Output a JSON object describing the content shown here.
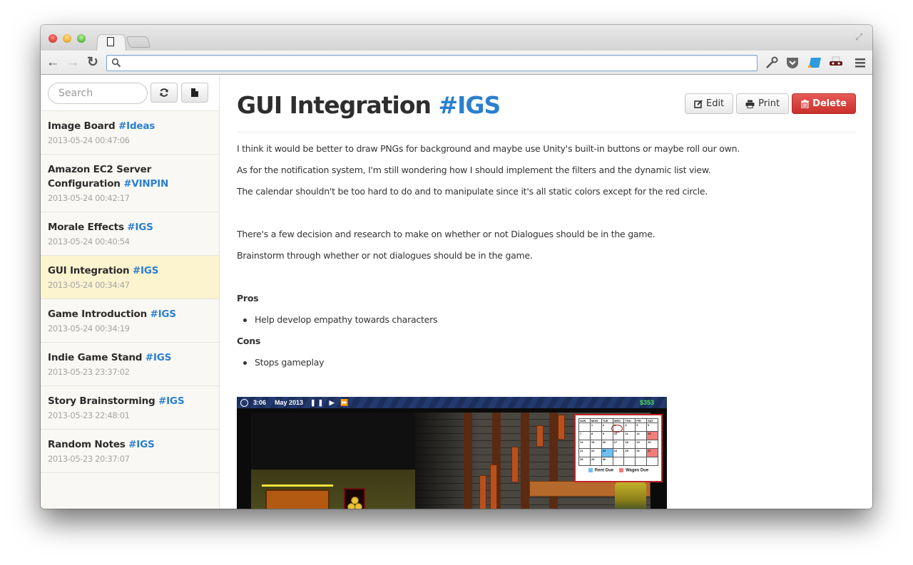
{
  "browser": {
    "tab_icon": "blank-page-icon",
    "address_value": "",
    "address_placeholder": "",
    "nav": {
      "back": "←",
      "forward": "→",
      "reload": "↻"
    },
    "extensions": [
      "wrench-icon",
      "pocket-icon",
      "blue-note-icon",
      "mask-icon",
      "menu-icon"
    ]
  },
  "sidebar": {
    "search_placeholder": "Search",
    "refresh_icon": "refresh-icon",
    "new_icon": "new-document-icon",
    "notes": [
      {
        "title": "Image Board",
        "tag": "#Ideas",
        "date": "2013-05-24 00:47:06",
        "active": false
      },
      {
        "title": "Amazon EC2 Server Configuration",
        "tag": "#VINPIN",
        "date": "2013-05-24 00:42:17",
        "active": false
      },
      {
        "title": "Morale Effects",
        "tag": "#IGS",
        "date": "2013-05-24 00:40:54",
        "active": false
      },
      {
        "title": "GUI Integration",
        "tag": "#IGS",
        "date": "2013-05-24 00:34:47",
        "active": true
      },
      {
        "title": "Game Introduction",
        "tag": "#IGS",
        "date": "2013-05-24 00:34:19",
        "active": false
      },
      {
        "title": "Indie Game Stand",
        "tag": "#IGS",
        "date": "2013-05-23 23:37:02",
        "active": false
      },
      {
        "title": "Story Brainstorming",
        "tag": "#IGS",
        "date": "2013-05-23 22:48:01",
        "active": false
      },
      {
        "title": "Random Notes",
        "tag": "#IGS",
        "date": "2013-05-23 20:37:07",
        "active": false
      }
    ]
  },
  "note": {
    "title": "GUI Integration",
    "tag": "#IGS",
    "actions": {
      "edit": "Edit",
      "print": "Print",
      "delete": "Delete"
    },
    "paragraphs_1": [
      "I think it would be better to draw PNGs for background and maybe use Unity's built-in buttons or maybe roll our own.",
      "As for the notification system, I'm still wondering how I should implement the filters and the dynamic list view.",
      "The calendar shouldn't be too hard to do and to manipulate since it's all static colors except for the red circle."
    ],
    "paragraphs_2": [
      "There's a few decision and research to make on whether or not Dialogues should be in the game.",
      "Brainstorm through whether or not dialogues should be in the game."
    ],
    "pros_heading": "Pros",
    "pros": [
      "Help develop empathy towards characters"
    ],
    "cons_heading": "Cons",
    "cons": [
      "Stops gameplay"
    ],
    "image": {
      "hud_time": "3:06",
      "hud_date": "May 2013",
      "hud_controls": "❚❚ ▶ ⏩",
      "hud_money": "$353",
      "calendar_days": [
        "SUN",
        "MON",
        "TUE",
        "WED",
        "THU",
        "FRI",
        "SAT"
      ],
      "calendar_cells": [
        "",
        "1",
        "2",
        "3",
        "4",
        "5",
        "6",
        "7",
        "8",
        "9",
        "10",
        "11",
        "12",
        "13",
        "14",
        "15",
        "16",
        "17",
        "18",
        "19",
        "20",
        "21",
        "22",
        "23",
        "24",
        "25",
        "26",
        "27",
        "28",
        "29",
        "30",
        "",
        "",
        "",
        ""
      ],
      "rent_due_days": [
        "23"
      ],
      "wages_due_days": [
        "13",
        "27"
      ],
      "legend_rent": "Rent Due",
      "legend_wages": "Wages Due",
      "colors": {
        "rent": "#6fbff3",
        "wages": "#f37c7c",
        "money": "#4be15a"
      }
    }
  },
  "colors": {
    "tag_blue": "#2a7fcf",
    "active_note_bg": "#fcf3cf",
    "delete_red": "#d9534f"
  }
}
